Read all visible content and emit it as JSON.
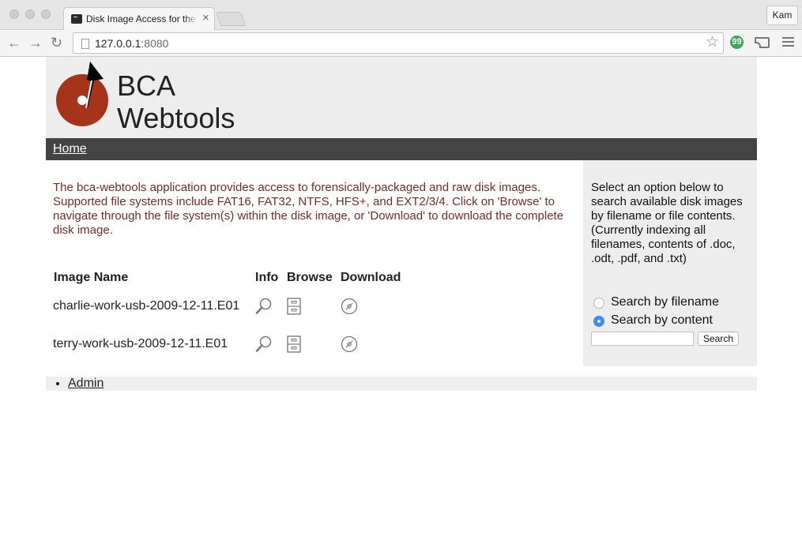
{
  "browser": {
    "tab_title": "Disk Image Access for the Web",
    "tab_close": "×",
    "url_host": "127.0.0.1",
    "url_port": ":8080",
    "profile": "Kam",
    "back_icon": "←",
    "forward_icon": "→",
    "reload_icon": "↻",
    "bookmark_icon": "☆",
    "extension_icon": "99"
  },
  "header": {
    "brand_line1": "BCA",
    "brand_line2": "Webtools",
    "logo_colors": {
      "disc": "#a5341b",
      "needle": "#000000"
    }
  },
  "nav": {
    "home_label": "Home"
  },
  "main": {
    "intro": "The bca-webtools application provides access to forensically-packaged and raw disk images. Supported file systems include FAT16, FAT32, NTFS, HFS+, and EXT2/3/4. Click on 'Browse' to navigate through the file system(s) within the disk image, or 'Download' to download the complete disk image.",
    "table": {
      "headers": [
        "Image Name",
        "Info",
        "Browse",
        "Download"
      ],
      "rows": [
        {
          "name": "charlie-work-usb-2009-12-11.E01"
        },
        {
          "name": "terry-work-usb-2009-12-11.E01"
        }
      ]
    }
  },
  "sidebar": {
    "description": "Select an option below to search available disk images by filename or file contents. (Currently indexing all filenames, contents of .doc, .odt, .pdf, and .txt)",
    "options": [
      {
        "label": "Search by filename",
        "selected": false
      },
      {
        "label": "Search by content",
        "selected": true
      }
    ],
    "search_value": "",
    "search_button": "Search"
  },
  "footer": {
    "admin_link": "Admin"
  },
  "colors": {
    "intro_text": "#7b2b1f",
    "nav_bar": "#444444",
    "panel_bg": "#ededed",
    "radio_selected": "#3d8bf0"
  }
}
